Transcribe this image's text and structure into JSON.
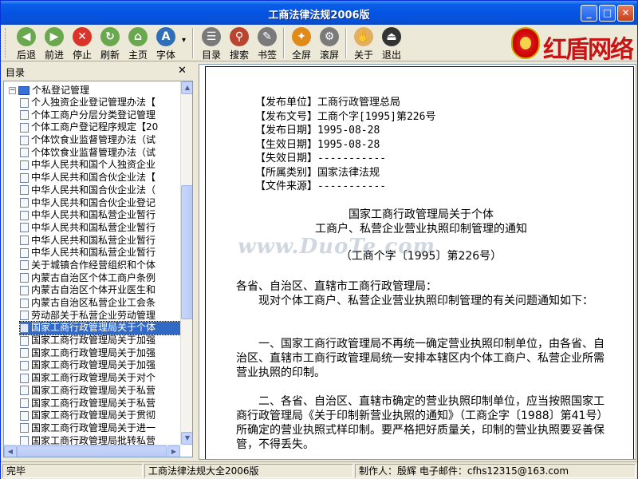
{
  "window": {
    "title": "工商法律法规2006版",
    "min_glyph": "_",
    "max_glyph": "□",
    "close_glyph": "✕"
  },
  "toolbar": {
    "buttons": [
      {
        "label": "后退",
        "glyph": "◀",
        "color": "#6aa84f"
      },
      {
        "label": "前进",
        "glyph": "▶",
        "color": "#6aa84f"
      },
      {
        "label": "停止",
        "glyph": "✕",
        "color": "#d9332a"
      },
      {
        "label": "刷新",
        "glyph": "↻",
        "color": "#6aa84f"
      },
      {
        "label": "主页",
        "glyph": "⌂",
        "color": "#6aa84f"
      },
      {
        "label": "字体",
        "glyph": "A",
        "color": "#2f6fb8"
      },
      {
        "label": "目录",
        "glyph": "☰",
        "color": "#7a7a7a"
      },
      {
        "label": "搜索",
        "glyph": "⚲",
        "color": "#b8452f"
      },
      {
        "label": "书签",
        "glyph": "✎",
        "color": "#7a7a7a"
      },
      {
        "label": "全屏",
        "glyph": "✦",
        "color": "#e08a1a"
      },
      {
        "label": "滚屏",
        "glyph": "⚙",
        "color": "#7a7a7a"
      },
      {
        "label": "关于",
        "glyph": "✋",
        "color": "#e0b060"
      },
      {
        "label": "退出",
        "glyph": "⏏",
        "color": "#333333"
      }
    ],
    "font_dropdown_glyph": "▾",
    "logo_text": "红盾网络"
  },
  "left_pane": {
    "title": "目录",
    "close_glyph": "✕",
    "root_label": "个私登记管理",
    "root_expander": "−",
    "items": [
      "个人独资企业登记管理办法【",
      "个体工商户分层分类登记管理",
      "个体工商户登记程序规定【20",
      "个体饮食业监督管理办法（试",
      "个体饮食业监督管理办法（试",
      "中华人民共和国个人独资企业",
      "中华人民共和国合伙企业法【",
      "中华人民共和国合伙企业法（",
      "中华人民共和国合伙企业登记",
      "中华人民共和国私营企业暂行",
      "中华人民共和国私营企业暂行",
      "中华人民共和国私营企业暂行",
      "中华人民共和国私营企业暂行",
      "关于城镇合作经营组织和个体",
      "内蒙古自治区个体工商户条例",
      "内蒙古自治区个体开业医生和",
      "内蒙古自治区私营企业工会条",
      "劳动部关于私营企业劳动管理",
      "国家工商行政管理局关于个体",
      "国家工商行政管理局关于加强",
      "国家工商行政管理局关于加强",
      "国家工商行政管理局关于加强",
      "国家工商行政管理局关于对个",
      "国家工商行政管理局关于私营",
      "国家工商行政管理局关于私营",
      "国家工商行政管理局关于贯彻",
      "国家工商行政管理局关于进一",
      "国家工商行政管理局批转私营"
    ],
    "selected_index": 18,
    "scroll_up": "▲",
    "scroll_down": "▼",
    "scroll_left": "◀",
    "scroll_right": "▶"
  },
  "document": {
    "meta": [
      {
        "label": "【发布单位】",
        "value": "工商行政管理总局"
      },
      {
        "label": "【发布文号】",
        "value": "工商个字[1995]第226号"
      },
      {
        "label": "【发布日期】",
        "value": "1995-08-28"
      },
      {
        "label": "【生效日期】",
        "value": "1995-08-28"
      },
      {
        "label": "【失效日期】",
        "value": "-----------"
      },
      {
        "label": "【所属类别】",
        "value": "国家法律法规"
      },
      {
        "label": "【文件来源】",
        "value": "-----------"
      }
    ],
    "title_line1": "国家工商行政管理局关于个体",
    "title_line2": "工商户、私营企业营业执照印制管理的通知",
    "doc_number": "（工商个字〔1995〕第226号）",
    "addressee": "各省、自治区、直辖市工商行政管理局：",
    "intro": "　　现对个体工商户、私营企业营业执照印制管理的有关问题通知如下：",
    "para1": "　　一、国家工商行政管理局不再统一确定营业执照印制单位，由各省、自治区、直辖市工商行政管理局统一安排本辖区内个体工商户、私营企业所需营业执照的印制。",
    "para2": "　　二、各省、自治区、直辖市确定的营业执照印制单位，应当按照国家工商行政管理局《关于印制新营业执照的通知》（工商企字〔1988〕第41号）所确定的营业执照式样印制。要严格把好质量关，印制的营业执照要妥善保管，不得丢失。",
    "watermark": "www.DuoTe.com"
  },
  "statusbar": {
    "status": "完毕",
    "product": "工商法律法规大全2006版",
    "author": "制作人：殷辉",
    "email": "电子邮件：cfhs12315@163.com"
  }
}
